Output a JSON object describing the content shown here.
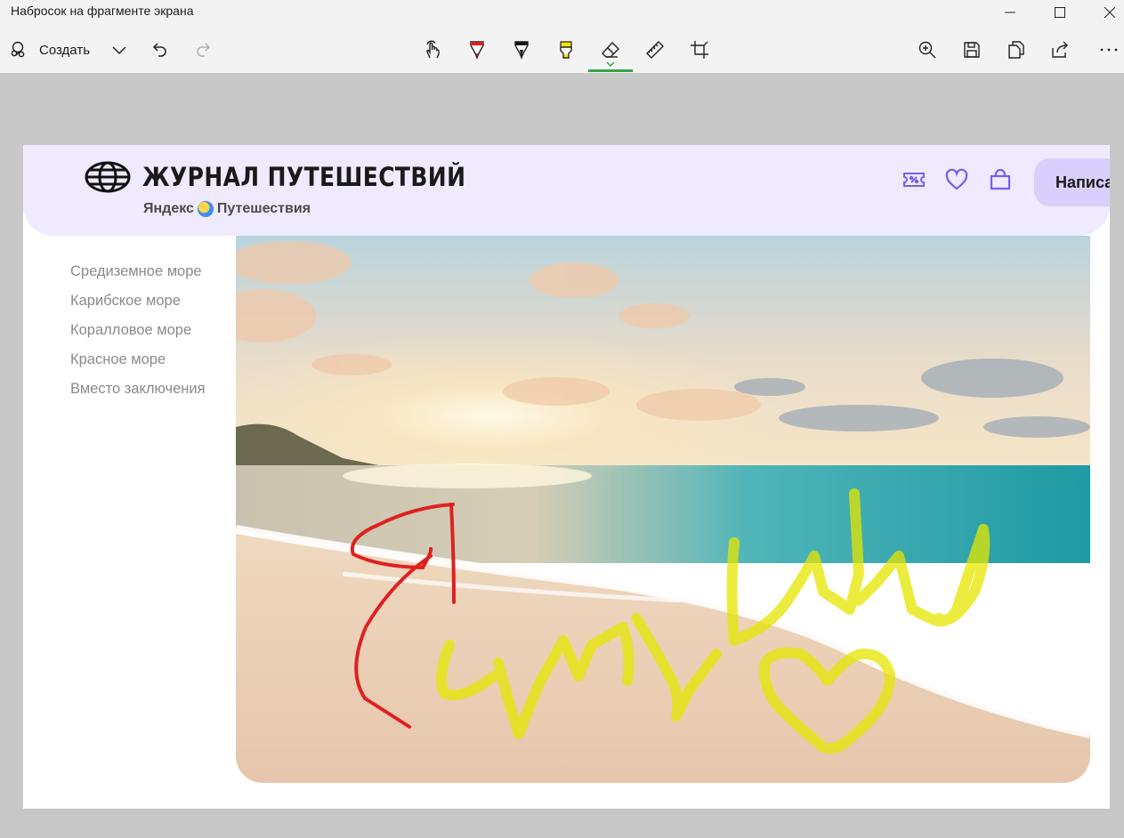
{
  "window": {
    "title": "Набросок на фрагменте экрана"
  },
  "toolbar": {
    "create_label": "Создать",
    "tools": [
      "touch-writing",
      "ballpoint-pen",
      "pencil",
      "highlighter",
      "eraser",
      "ruler",
      "crop"
    ],
    "active_tool": "eraser"
  },
  "site": {
    "logo_title": "ЖУРНАЛ ПУТЕШЕСТВИЙ",
    "brand_left": "Яндекс",
    "brand_right": "Путешествия",
    "write_button": "Написа",
    "toc": [
      "Средиземное море",
      "Карибское море",
      "Коралловое море",
      "Красное море",
      "Вместо заключения"
    ]
  },
  "colors": {
    "accent_green": "#3aa34a",
    "header_bg": "#efeafe",
    "header_icon": "#7b5cf0",
    "pen_red": "#e02020",
    "highlighter_yellow": "#e6e600"
  }
}
